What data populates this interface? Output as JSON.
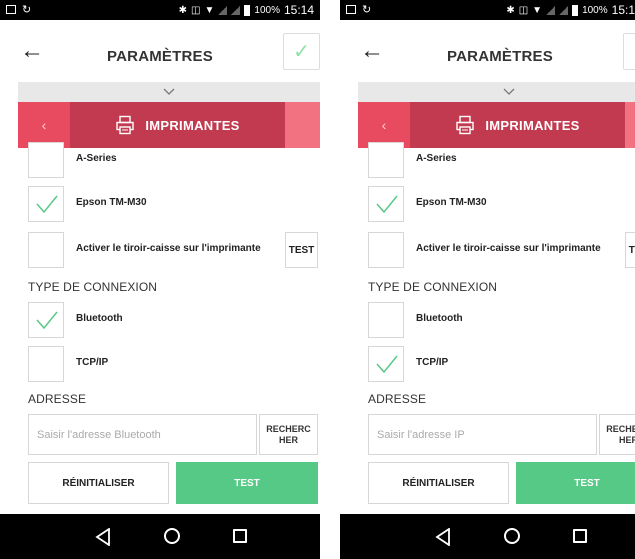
{
  "screens": [
    {
      "status": {
        "battery_pct": "100%",
        "time": "15:14"
      },
      "header": {
        "title": "PARAMÈTRES"
      },
      "band": {
        "title": "IMPRIMANTES"
      },
      "printers": [
        {
          "label": "A-Series",
          "checked": false
        },
        {
          "label": "Epson TM-M30",
          "checked": true
        }
      ],
      "drawer": {
        "label": "Activer le tiroir-caisse sur l'imprimante",
        "test_label": "TEST"
      },
      "connection": {
        "heading": "TYPE DE CONNEXION",
        "options": [
          {
            "label": "Bluetooth",
            "checked": true
          },
          {
            "label": "TCP/IP",
            "checked": false
          }
        ]
      },
      "address": {
        "heading": "ADRESSE",
        "placeholder": "Saisir l'adresse Bluetooth",
        "search_line1": "RECHERC",
        "search_line2": "HER"
      },
      "actions": {
        "reset": "RÉINITIALISER",
        "test": "TEST"
      }
    },
    {
      "status": {
        "battery_pct": "100%",
        "time": "15:1"
      },
      "header": {
        "title": "PARAMÈTRES"
      },
      "band": {
        "title": "IMPRIMANTES"
      },
      "printers": [
        {
          "label": "A-Series",
          "checked": false
        },
        {
          "label": "Epson TM-M30",
          "checked": true
        }
      ],
      "drawer": {
        "label": "Activer le tiroir-caisse sur l'imprimante",
        "test_label": "TEST"
      },
      "connection": {
        "heading": "TYPE DE CONNEXION",
        "options": [
          {
            "label": "Bluetooth",
            "checked": false
          },
          {
            "label": "TCP/IP",
            "checked": true
          }
        ]
      },
      "address": {
        "heading": "ADRESSE",
        "placeholder": "Saisir l'adresse IP",
        "search_line1": "RECHERC",
        "search_line2": "HER"
      },
      "actions": {
        "reset": "RÉINITIALISER",
        "test": "TEST"
      }
    }
  ],
  "colors": {
    "band": "#e84a5f",
    "band_active": "#c23a4f",
    "band_next": "#f37282",
    "check": "#57c986",
    "test_button": "#57c986"
  },
  "icons": [
    "back-arrow-icon",
    "checkmark-icon",
    "chevron-down-icon",
    "printer-icon",
    "chevron-left-icon",
    "nav-back-icon",
    "nav-home-icon",
    "nav-recent-icon"
  ]
}
